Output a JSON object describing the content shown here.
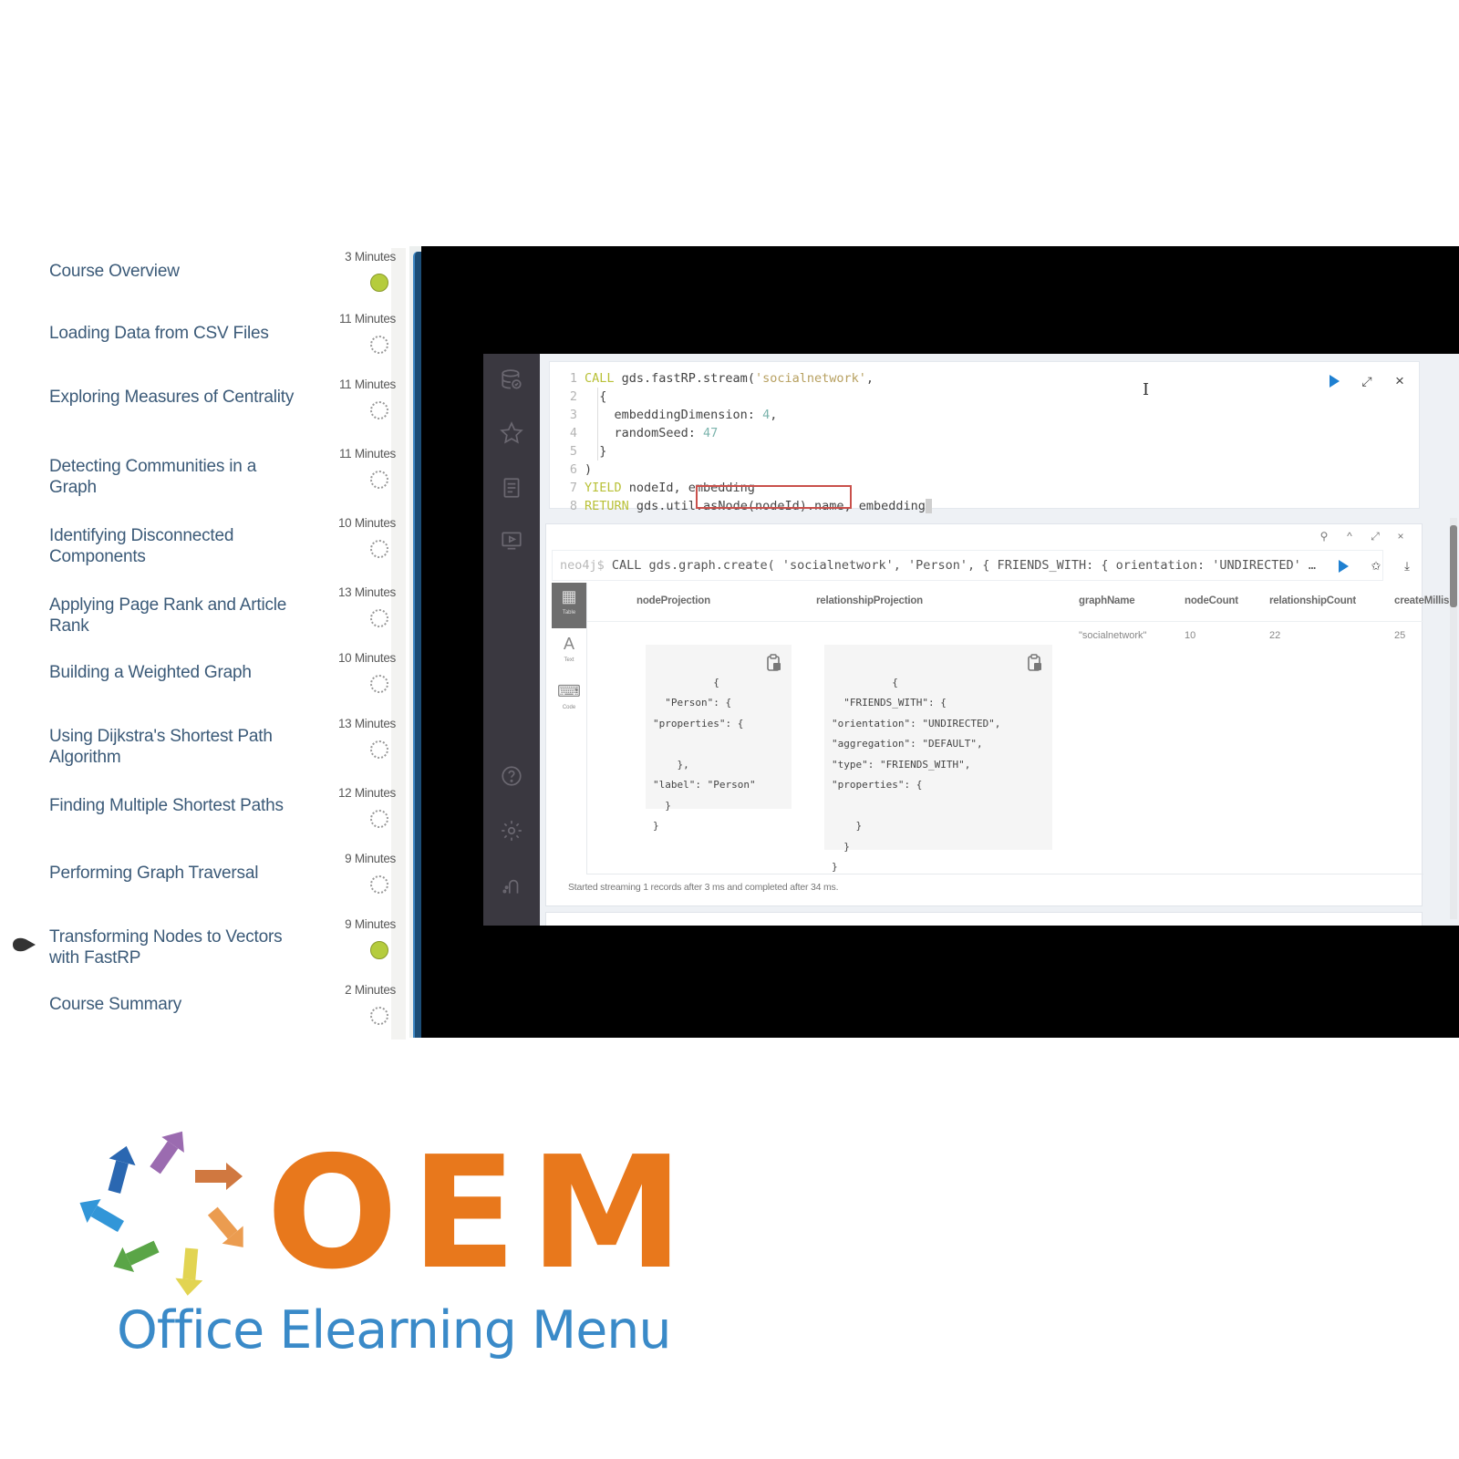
{
  "course": {
    "lessons": [
      {
        "title": "Course Overview",
        "duration": "3 Minutes",
        "status": "completed"
      },
      {
        "title": "Loading Data from CSV Files",
        "duration": "11 Minutes",
        "status": "not-started"
      },
      {
        "title": "Exploring Measures of Centrality",
        "duration": "11 Minutes",
        "status": "not-started"
      },
      {
        "title": "Detecting Communities in a Graph",
        "duration": "11 Minutes",
        "status": "not-started"
      },
      {
        "title": "Identifying Disconnected Components",
        "duration": "10 Minutes",
        "status": "not-started"
      },
      {
        "title": "Applying Page Rank and Article Rank",
        "duration": "13 Minutes",
        "status": "not-started"
      },
      {
        "title": "Building a Weighted Graph",
        "duration": "10 Minutes",
        "status": "not-started"
      },
      {
        "title": "Using Dijkstra's Shortest Path Algorithm",
        "duration": "13 Minutes",
        "status": "not-started"
      },
      {
        "title": "Finding Multiple Shortest Paths",
        "duration": "12 Minutes",
        "status": "not-started"
      },
      {
        "title": "Performing Graph Traversal",
        "duration": "9 Minutes",
        "status": "not-started"
      },
      {
        "title": "Transforming Nodes to Vectors with FastRP",
        "duration": "9 Minutes",
        "status": "completed",
        "current": true
      },
      {
        "title": "Course Summary",
        "duration": "2 Minutes",
        "status": "not-started"
      }
    ]
  },
  "video": {
    "sidebar_icons": [
      "database-icon",
      "star-icon",
      "document-icon",
      "play-screen-icon",
      "help-icon",
      "settings-icon",
      "plug-icon"
    ],
    "editor": {
      "line_numbers": [
        "1",
        "2",
        "3",
        "4",
        "5",
        "6",
        "7",
        "8"
      ],
      "lines": {
        "l1": {
          "kw": "CALL",
          "text": " gds.fastRP.stream(",
          "str": "'socialnetwork'",
          "tail": ","
        },
        "l2": "  {",
        "l3": {
          "text": "    embeddingDimension: ",
          "num": "4",
          "tail": ","
        },
        "l4": {
          "text": "    randomSeed: ",
          "num": "47"
        },
        "l5": "  }",
        "l6": ")",
        "l7": {
          "kw": "YIELD",
          "text": " nodeId, embedding"
        },
        "l8": {
          "kw": "RETURN",
          "text": " gds.util.asNode(nodeId).name, embedding"
        }
      },
      "highlighted": "nodeId, embedding",
      "actions": {
        "run": "run-icon",
        "expand": "expand-icon",
        "close": "×"
      }
    },
    "result": {
      "prompt": "neo4j$",
      "command": "CALL gds.graph.create( 'socialnetwork', 'Person', { FRIENDS_WITH: { orientation: 'UNDIRECTED' …",
      "frame_actions": {
        "pin": "pin-icon",
        "collapse": "^",
        "fullscreen": "expand-icon",
        "close": "×"
      },
      "view_tabs": [
        {
          "label": "Table",
          "icon": "table-icon",
          "active": true
        },
        {
          "label": "Text",
          "icon": "A",
          "active": false
        },
        {
          "label": "Code",
          "icon": "code-icon",
          "active": false
        }
      ],
      "columns": [
        "nodeProjection",
        "relationshipProjection",
        "graphName",
        "nodeCount",
        "relationshipCount",
        "createMillis"
      ],
      "row": {
        "nodeProjection": "{\n  \"Person\": {\n\"properties\": {\n\n    },\n\"label\": \"Person\"\n  }\n}",
        "relationshipProjection": "{\n  \"FRIENDS_WITH\": {\n\"orientation\": \"UNDIRECTED\",\n\"aggregation\": \"DEFAULT\",\n\"type\": \"FRIENDS_WITH\",\n\"properties\": {\n\n    }\n  }\n}",
        "graphName": "\"socialnetwork\"",
        "nodeCount": "10",
        "relationshipCount": "22",
        "createMillis": "25"
      },
      "status": "Started streaming 1 records after 3 ms and completed after 34 ms."
    }
  },
  "logo": {
    "letters": "OEM",
    "tagline": "Office Elearning Menu",
    "colors": {
      "letters": "#e8781c",
      "tagline": "#3a8ac8"
    }
  },
  "colors": {
    "lesson_title": "#3b5a78",
    "completed": "#b5cc3d",
    "run_button": "#1f80d1",
    "highlight_box": "#c9504b"
  }
}
